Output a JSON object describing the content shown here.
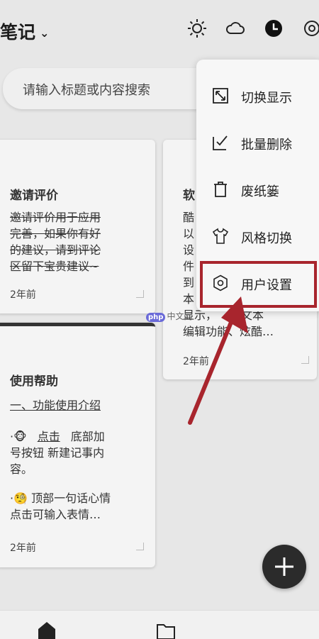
{
  "header": {
    "title": "笔记"
  },
  "search": {
    "placeholder": "请输入标题或内容搜索"
  },
  "cards": [
    {
      "title": "邀请评价",
      "lines": [
        "邀请评价用于应用",
        "完善，如果你有好",
        "的建议，请到评论",
        "区留下宝贵建议~"
      ],
      "time": "2年前"
    },
    {
      "title": "软",
      "lines": [
        "酷",
        "以",
        "设",
        "件",
        "到",
        "本",
        "显示，",
        "的文本",
        "编辑功能、炫酷…"
      ],
      "time": "2年前"
    },
    {
      "title": "使用帮助",
      "subtitle": "一、功能使用介绍",
      "lines": [
        "点击",
        "底部加",
        "号按钮 新建记事内",
        "容。",
        "顶部一句话心情",
        "点击可输入表情…"
      ],
      "time": "2年前"
    }
  ],
  "menu": {
    "items": [
      "切换显示",
      "批量删除",
      "废纸篓",
      "风格切换",
      "用户设置"
    ]
  },
  "watermark": {
    "brand": "php",
    "text": "中文网"
  }
}
